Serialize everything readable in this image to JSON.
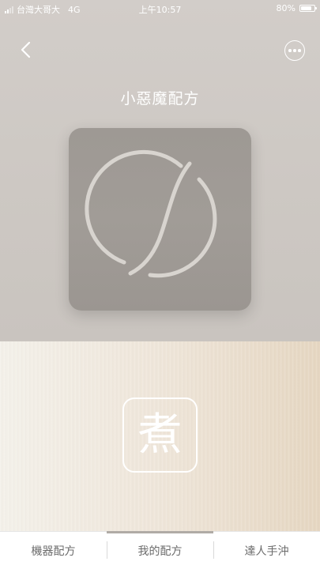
{
  "status_bar": {
    "carrier": "台灣大哥大",
    "network": "4G",
    "time": "上午10:57",
    "battery_text": "80%",
    "battery_level": 0.8
  },
  "header": {
    "back_icon": "chevron-left-icon",
    "more_icon": "more-horizontal-icon",
    "title": "小惡魔配方"
  },
  "recipe": {
    "icon": "recipe-logo-icon"
  },
  "cook": {
    "label": "煮"
  },
  "tabs": [
    {
      "label": "機器配方",
      "active": false
    },
    {
      "label": "我的配方",
      "active": true
    },
    {
      "label": "達人手沖",
      "active": false
    }
  ],
  "colors": {
    "top_background": "#cdc8c3",
    "card_background": "#a09b96",
    "tab_text": "#6b6b6b",
    "tab_active_indicator": "#b0aba6"
  }
}
